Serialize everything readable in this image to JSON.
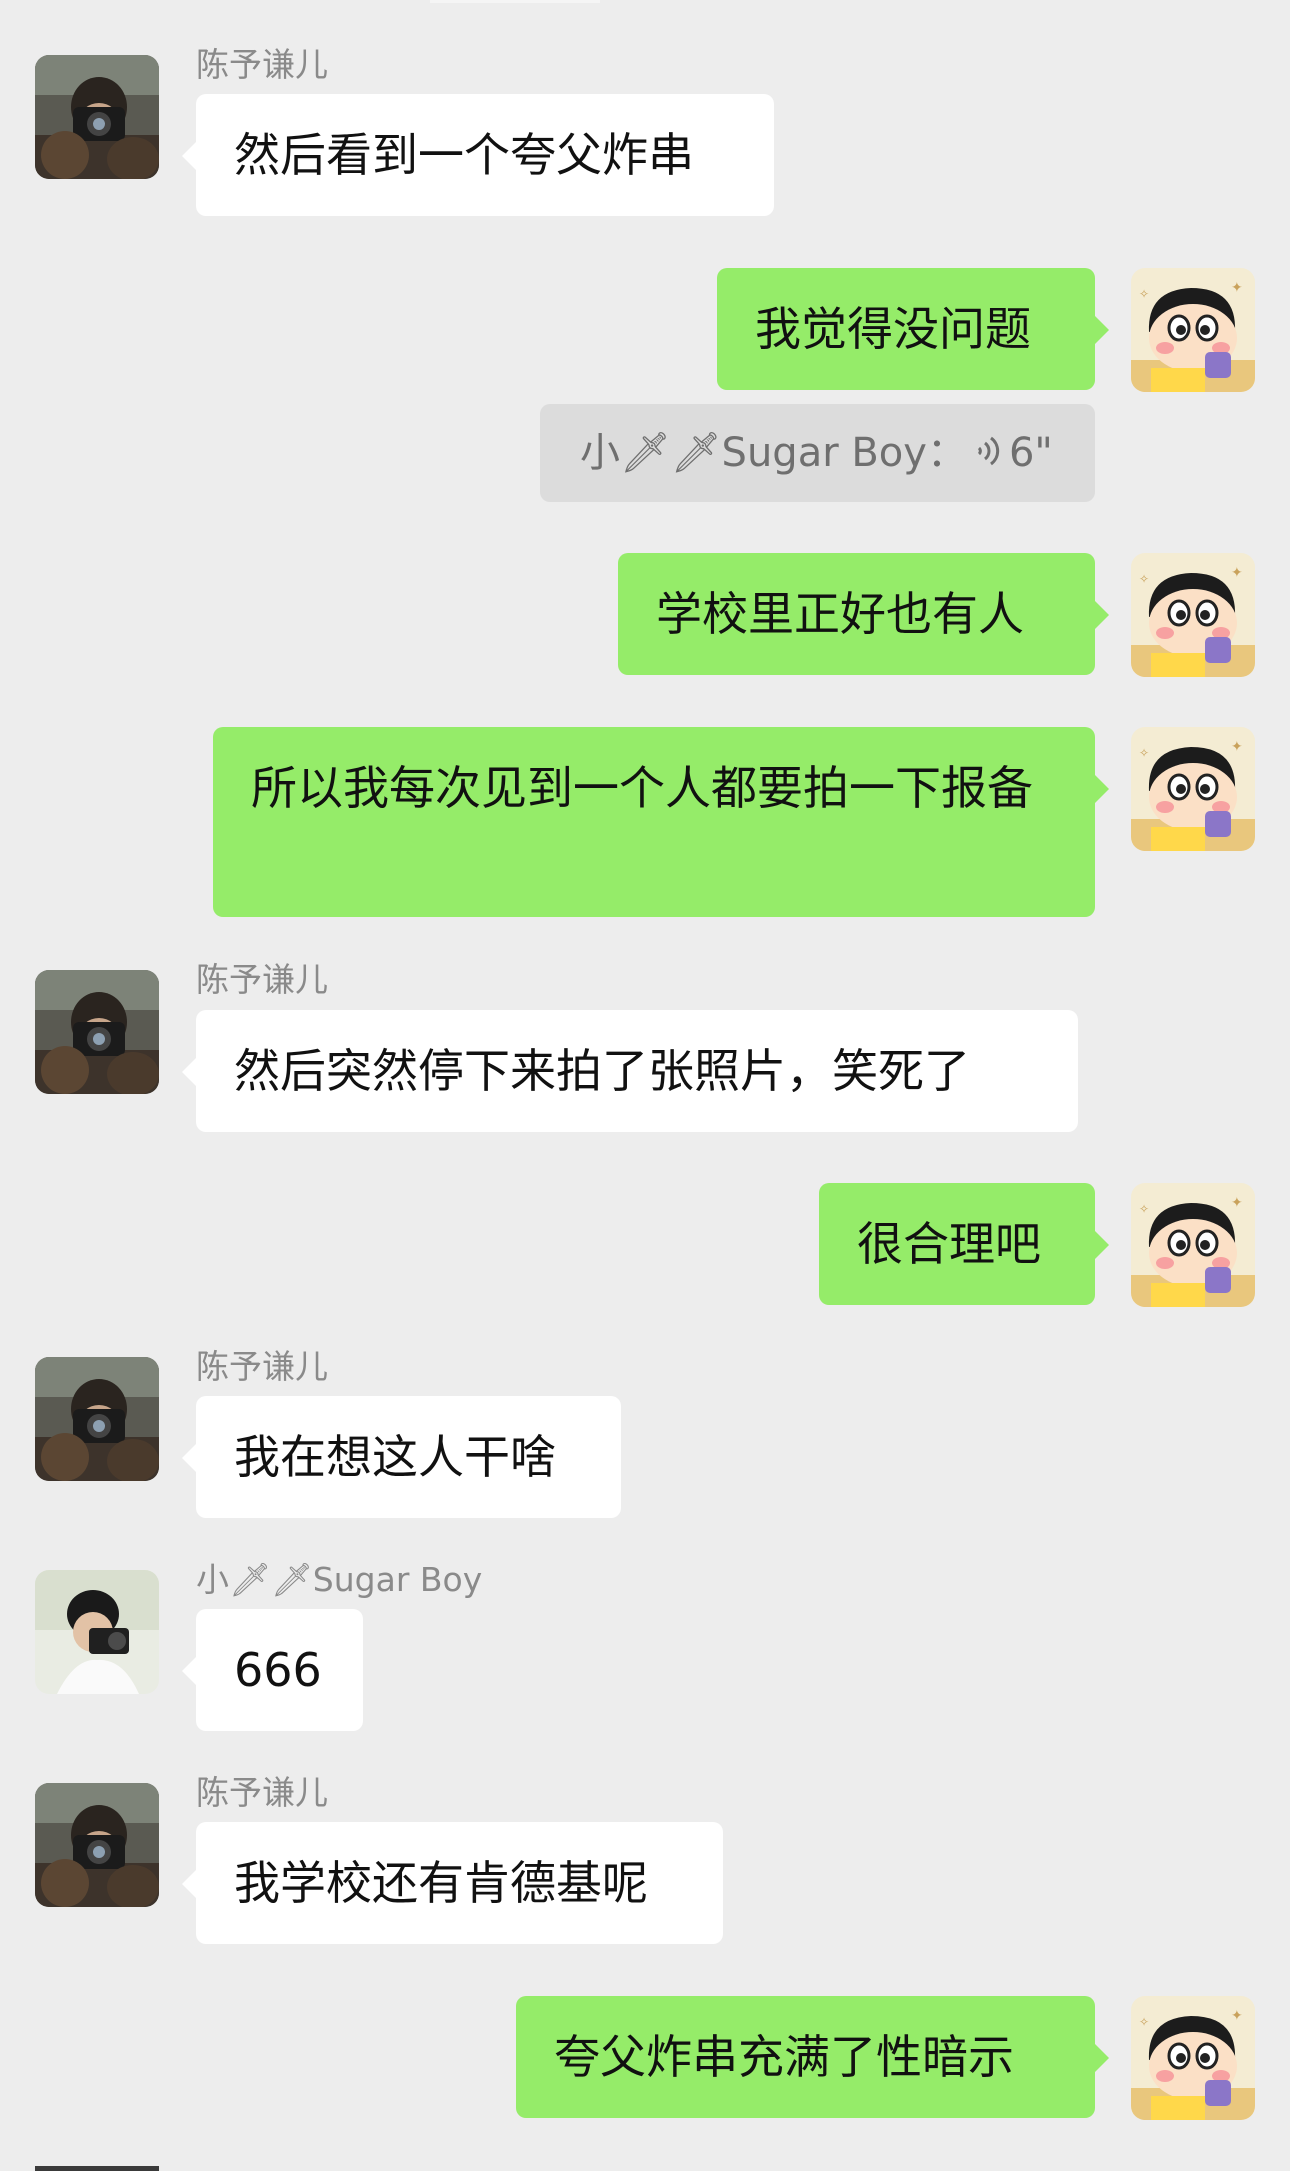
{
  "colors": {
    "background": "#ededed",
    "incoming_bubble": "#ffffff",
    "outgoing_bubble": "#95ec69",
    "system_notice": "#dcdcdc"
  },
  "icons": {
    "knife": "knife-emoji",
    "voice": "voice-wave-icon"
  },
  "messages": [
    {
      "direction": "in",
      "sender": "陈予谦儿",
      "text": "然后看到一个夸父炸串"
    },
    {
      "direction": "out",
      "text": "我觉得没问题"
    },
    {
      "type": "voice_notice",
      "sender": "小🗡🗡Sugar Boy",
      "duration": "6\""
    },
    {
      "direction": "out",
      "text": "学校里正好也有人"
    },
    {
      "direction": "out",
      "text": "所以我每次见到一个人都要拍一下报备"
    },
    {
      "direction": "in",
      "sender": "陈予谦儿",
      "text": "然后突然停下来拍了张照片，笑死了"
    },
    {
      "direction": "out",
      "text": "很合理吧"
    },
    {
      "direction": "in",
      "sender": "陈予谦儿",
      "text": "我在想这人干啥"
    },
    {
      "direction": "in",
      "sender": "小🗡🗡Sugar Boy",
      "text": "666"
    },
    {
      "direction": "in",
      "sender": "陈予谦儿",
      "text": "我学校还有肯德基呢"
    },
    {
      "direction": "out",
      "text": "夸父炸串充满了性暗示"
    }
  ]
}
